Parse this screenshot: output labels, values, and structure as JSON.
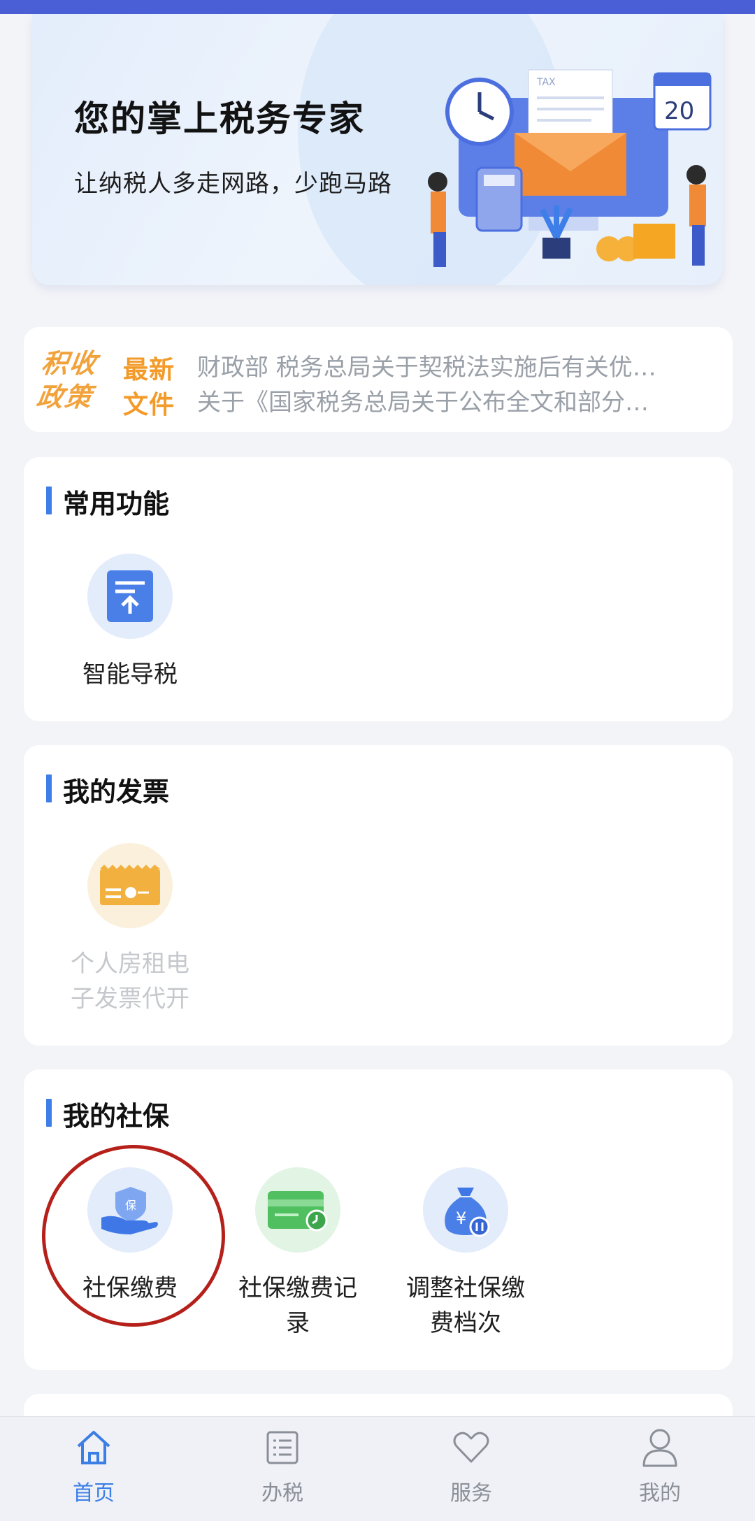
{
  "banner": {
    "title": "您的掌上税务专家",
    "subtitle": "让纳税人多走网路，少跑马路",
    "calendar_day": "20",
    "art_tax_label": "TAX"
  },
  "news": {
    "badge_line1": "积收",
    "badge_line2": "政策",
    "items": [
      {
        "tag": "最新",
        "text": "财政部 税务总局关于契税法实施后有关优…"
      },
      {
        "tag": "文件",
        "text": "关于《国家税务总局关于公布全文和部分…"
      }
    ]
  },
  "sections": {
    "common": {
      "title": "常用功能",
      "items": [
        {
          "label": "智能导税",
          "icon": "upload-document-icon"
        }
      ]
    },
    "invoice": {
      "title": "我的发票",
      "items": [
        {
          "label": "个人房租电子发票代开",
          "icon": "invoice-ticket-icon",
          "enabled": false
        }
      ]
    },
    "social": {
      "title": "我的社保",
      "items": [
        {
          "label": "社保缴费",
          "icon": "hand-shield-icon"
        },
        {
          "label": "社保缴费记录",
          "icon": "card-record-icon"
        },
        {
          "label": "调整社保缴费档次",
          "icon": "money-bag-icon"
        }
      ]
    }
  },
  "bottom_nav": [
    {
      "label": "首页",
      "icon": "home-icon",
      "active": true
    },
    {
      "label": "办税",
      "icon": "list-icon",
      "active": false
    },
    {
      "label": "服务",
      "icon": "heart-icon",
      "active": false
    },
    {
      "label": "我的",
      "icon": "user-icon",
      "active": false
    }
  ],
  "colors": {
    "accent": "#3b7ee6",
    "orange": "#f39a28",
    "highlight_ring": "#b5201a"
  }
}
